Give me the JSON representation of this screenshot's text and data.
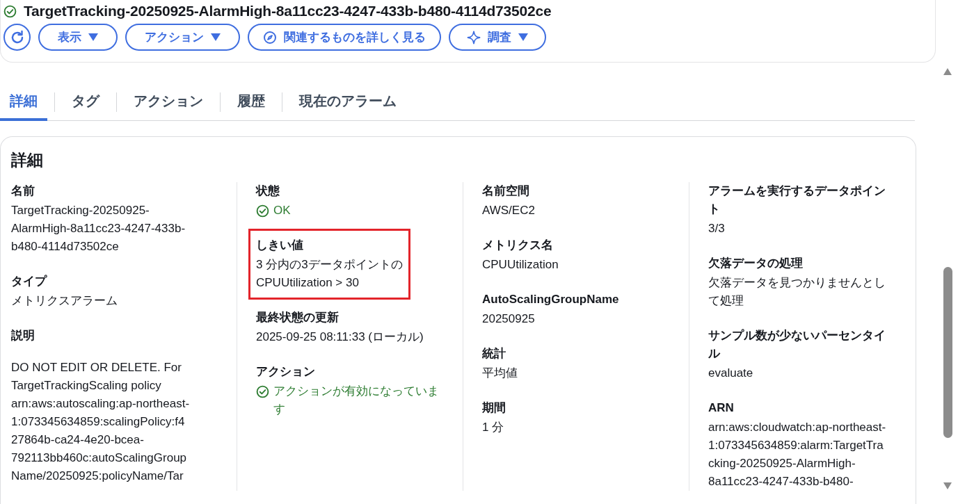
{
  "title": {
    "text": "TargetTracking-20250925-AlarmHigh-8a11cc23-4247-433b-b480-4114d73502ce"
  },
  "toolbar": [
    {
      "kind": "refresh"
    },
    {
      "kind": "dropdown",
      "label": "表示"
    },
    {
      "kind": "dropdown",
      "label": "アクション"
    },
    {
      "kind": "compass",
      "label": "関連するものを詳しく見る"
    },
    {
      "kind": "sparkle-dropdown",
      "label": "調査"
    }
  ],
  "tabs": [
    {
      "label": "詳細",
      "selected": true
    },
    {
      "label": "タグ",
      "selected": false
    },
    {
      "label": "アクション",
      "selected": false
    },
    {
      "label": "履歴",
      "selected": false
    },
    {
      "label": "現在のアラーム",
      "selected": false
    }
  ],
  "details": {
    "heading": "詳細",
    "columns": [
      [
        {
          "label": [
            "名前"
          ],
          "value": [
            "TargetTracking-20250925-",
            "AlarmHigh-8a11cc23-4247-433b-",
            "b480-4114d73502ce"
          ],
          "kind": "text"
        },
        {
          "label": [
            "タイプ"
          ],
          "value": [
            "メトリクスアラーム"
          ],
          "kind": "text"
        },
        {
          "label": [
            "説明"
          ],
          "value": [
            "DO NOT EDIT OR DELETE. For",
            "TargetTrackingScaling policy",
            "arn:aws:autoscaling:ap-northeast-",
            "1:073345634859:scalingPolicy:f4",
            "27864b-ca24-4e20-bcea-",
            "792113bb460c:autoScalingGroup",
            "Name/20250925:policyName/Tar"
          ],
          "kind": "paragraph"
        }
      ],
      [
        {
          "label": [
            "状態"
          ],
          "value": [
            "OK"
          ],
          "kind": "status"
        },
        {
          "label": [
            "しきい値"
          ],
          "value": [
            "3 分内の3データポイントの",
            "CPUUtilization > 30"
          ],
          "kind": "text",
          "highlighted": true
        },
        {
          "label": [
            "最終状態の更新"
          ],
          "value": [
            "2025-09-25 08:11:33 (ローカル)"
          ],
          "kind": "text"
        },
        {
          "label": [
            "アクション"
          ],
          "value": [
            "アクションが有効になっていま",
            "す"
          ],
          "kind": "status"
        }
      ],
      [
        {
          "label": [
            "名前空間"
          ],
          "value": [
            "AWS/EC2"
          ],
          "kind": "text"
        },
        {
          "label": [
            "メトリクス名"
          ],
          "value": [
            "CPUUtilization"
          ],
          "kind": "text"
        },
        {
          "label": [
            "AutoScalingGroupName"
          ],
          "value": [
            "20250925"
          ],
          "kind": "text"
        },
        {
          "label": [
            "統計"
          ],
          "value": [
            "平均値"
          ],
          "kind": "text"
        },
        {
          "label": [
            "期間"
          ],
          "value": [
            "1 分"
          ],
          "kind": "text"
        }
      ],
      [
        {
          "label": [
            "アラームを実行するデータポイン",
            "ト"
          ],
          "value": [
            "3/3"
          ],
          "kind": "text"
        },
        {
          "label": [
            "欠落データの処理"
          ],
          "value": [
            "欠落データを見つかりませんとし",
            "て処理"
          ],
          "kind": "text"
        },
        {
          "label": [
            "サンプル数が少ないパーセンタイ",
            "ル"
          ],
          "value": [
            "evaluate"
          ],
          "kind": "text"
        },
        {
          "label": [
            "ARN"
          ],
          "value": [
            "arn:aws:cloudwatch:ap-northeast-",
            "1:073345634859:alarm:TargetTra",
            "cking-20250925-AlarmHigh-",
            "8a11cc23-4247-433b-b480-"
          ],
          "kind": "text"
        }
      ]
    ]
  }
}
